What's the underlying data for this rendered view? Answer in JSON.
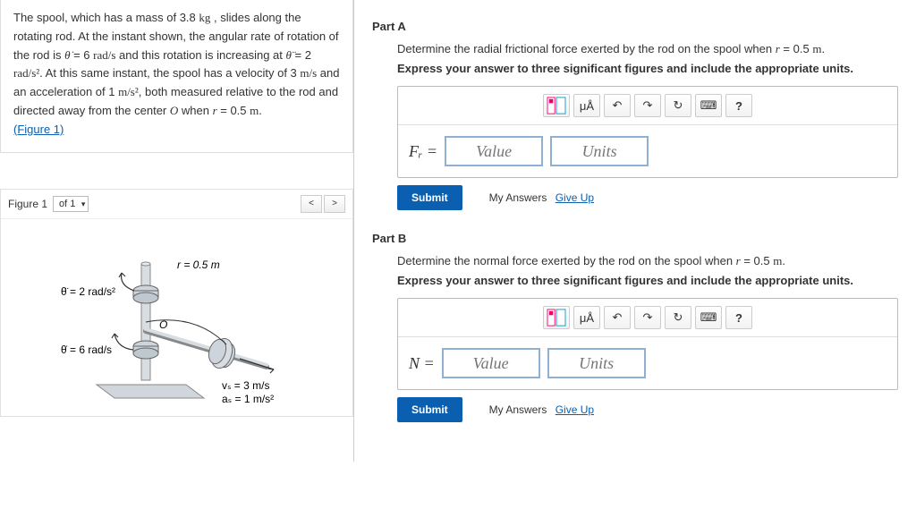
{
  "problem": {
    "line1": "The spool, which has a mass of 3.8 kg , slides along the rotating rod. At the instant shown, the angular rate of rotation of the rod is θ̇ = 6 rad/s and this rotation is increasing at θ̈ = 2 rad/s². At this same instant, the spool has a velocity of 3 m/s and an acceleration of 1 m/s², both measured relative to the rod and directed away from the center O when r = 0.5 m.",
    "figlink": "(Figure 1)"
  },
  "figure": {
    "label": "Figure 1",
    "selector": "of 1",
    "ann": {
      "r": "r = 0.5 m",
      "thetadd": "θ̈ = 2 rad/s²",
      "thetad": "θ̇ = 6 rad/s",
      "O": "O",
      "vs": "vₛ = 3 m/s",
      "as": "aₛ = 1 m/s²"
    }
  },
  "partA": {
    "header": "Part A",
    "question": "Determine the radial frictional force exerted by the rod on the spool when r = 0.5 m.",
    "instruction": "Express your answer to three significant figures and include the appropriate units.",
    "var": "Fᵣ =",
    "value_ph": "Value",
    "units_ph": "Units",
    "submit": "Submit",
    "myans": "My Answers",
    "giveup": "Give Up"
  },
  "partB": {
    "header": "Part B",
    "question": "Determine the normal force exerted by the rod on the spool when r = 0.5 m.",
    "instruction": "Express your answer to three significant figures and include the appropriate units.",
    "var": "N =",
    "value_ph": "Value",
    "units_ph": "Units",
    "submit": "Submit",
    "myans": "My Answers",
    "giveup": "Give Up"
  },
  "toolbar": {
    "units_symbol": "μÅ",
    "help": "?"
  }
}
